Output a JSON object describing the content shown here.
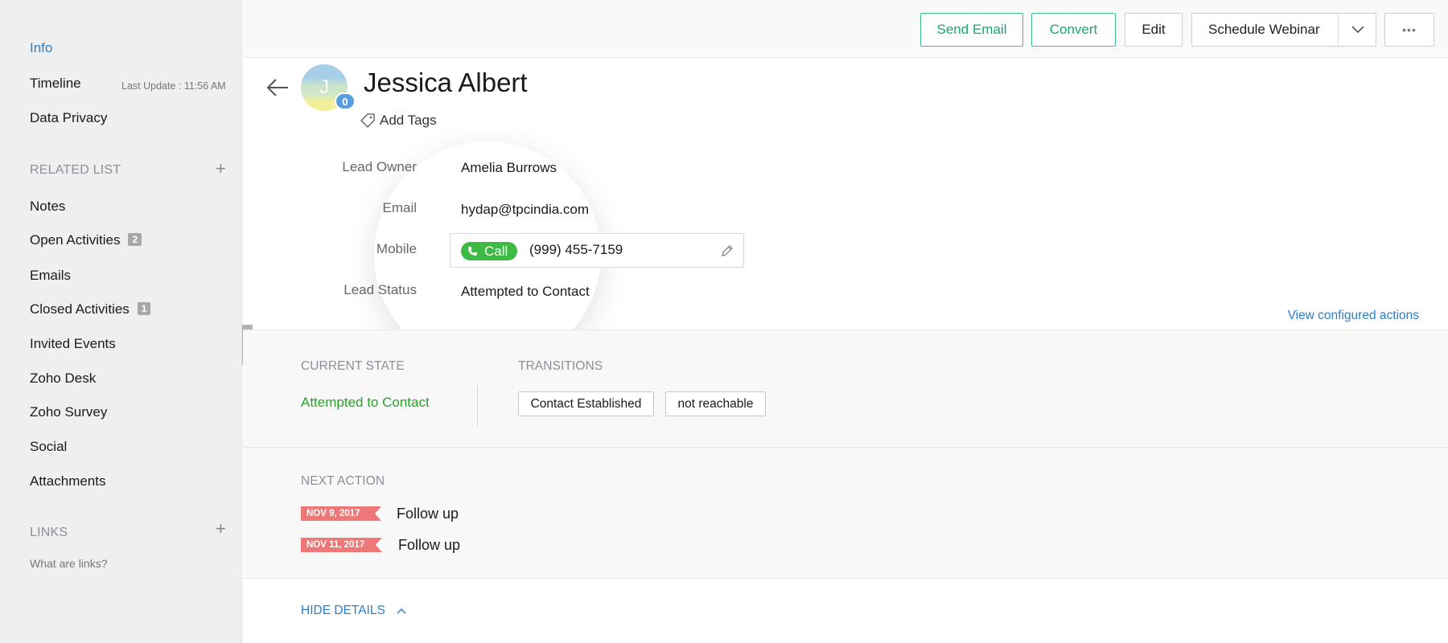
{
  "sidebar": {
    "nav": [
      {
        "label": "Info",
        "active": true
      },
      {
        "label": "Timeline"
      },
      {
        "label": "Data Privacy"
      }
    ],
    "last_update": "Last Update : 11:56 AM",
    "related_list_title": "RELATED LIST",
    "related_items": [
      {
        "label": "Notes"
      },
      {
        "label": "Open Activities",
        "count": "2"
      },
      {
        "label": "Emails"
      },
      {
        "label": "Closed Activities",
        "count": "1"
      },
      {
        "label": "Invited Events"
      },
      {
        "label": "Zoho Desk"
      },
      {
        "label": "Zoho Survey"
      },
      {
        "label": "Social"
      },
      {
        "label": "Attachments"
      }
    ],
    "links_title": "LINKS",
    "links_help": "What are links?",
    "add_symbol": "+"
  },
  "header": {
    "send_email": "Send Email",
    "convert": "Convert",
    "edit": "Edit",
    "schedule_webinar": "Schedule Webinar",
    "more_symbol": "•••"
  },
  "record": {
    "avatar_initial": "J",
    "avatar_badge": "0",
    "name": "Jessica Albert",
    "add_tags": "Add Tags",
    "fields": [
      {
        "label": "Lead Owner",
        "value": "Amelia Burrows"
      },
      {
        "label": "Email",
        "value": "hydap@tpcindia.com"
      },
      {
        "label": "Mobile",
        "value": "(999) 455-7159",
        "call_label": "Call"
      },
      {
        "label": "Lead Status",
        "value": "Attempted to Contact"
      }
    ]
  },
  "blueprint": {
    "view_configured_actions": "View configured actions",
    "current_state_title": "CURRENT STATE",
    "current_state": "Attempted to Contact",
    "transitions_title": "TRANSITIONS",
    "transitions": [
      "Contact Established",
      "not reachable"
    ]
  },
  "next_action": {
    "title": "NEXT ACTION",
    "items": [
      {
        "date": "NOV 9, 2017",
        "label": "Follow up"
      },
      {
        "date": "NOV 11, 2017",
        "label": "Follow up"
      }
    ]
  },
  "hide_details": "HIDE DETAILS",
  "colors": {
    "accent_blue": "#2a7fc9",
    "green": "#18a86d",
    "call_green": "#3dba43",
    "state_green": "#2aa12a",
    "date_red": "#ee7878"
  }
}
